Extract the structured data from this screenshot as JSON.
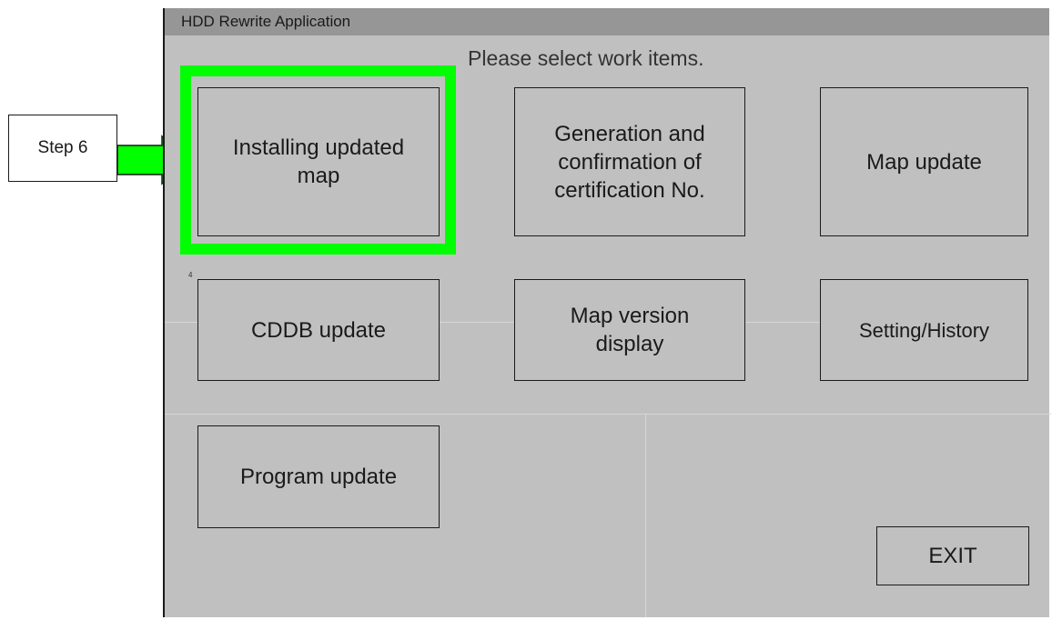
{
  "window": {
    "title": "HDD Rewrite Application"
  },
  "prompt": "Please select work items.",
  "buttons": {
    "installing_updated_map": "Installing updated\nmap",
    "generation_confirmation": "Generation and\nconfirmation of\ncertification No.",
    "map_update": "Map update",
    "cddb_update": "CDDB update",
    "map_version_display": "Map version\ndisplay",
    "setting_history": "Setting/History",
    "program_update": "Program update",
    "exit": "EXIT"
  },
  "annotation": {
    "step_label": "Step 6",
    "highlight_color": "#00ff00",
    "tiny_mark": "4"
  }
}
